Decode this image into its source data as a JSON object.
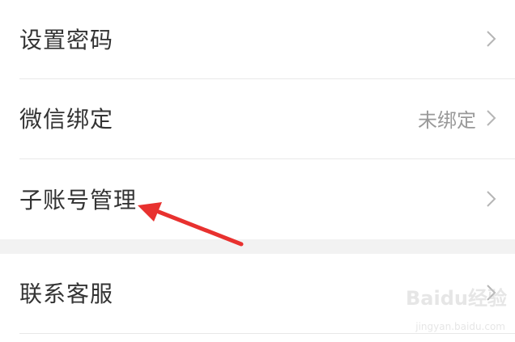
{
  "settings": {
    "items": [
      {
        "label": "设置密码",
        "value": ""
      },
      {
        "label": "微信绑定",
        "value": "未绑定"
      },
      {
        "label": "子账号管理",
        "value": ""
      },
      {
        "label": "联系客服",
        "value": ""
      }
    ]
  },
  "annotation": {
    "arrow_color": "#e8312f"
  },
  "watermark": {
    "logo_text": "Baidu经验",
    "url_text": "jingyan.baidu.com"
  }
}
